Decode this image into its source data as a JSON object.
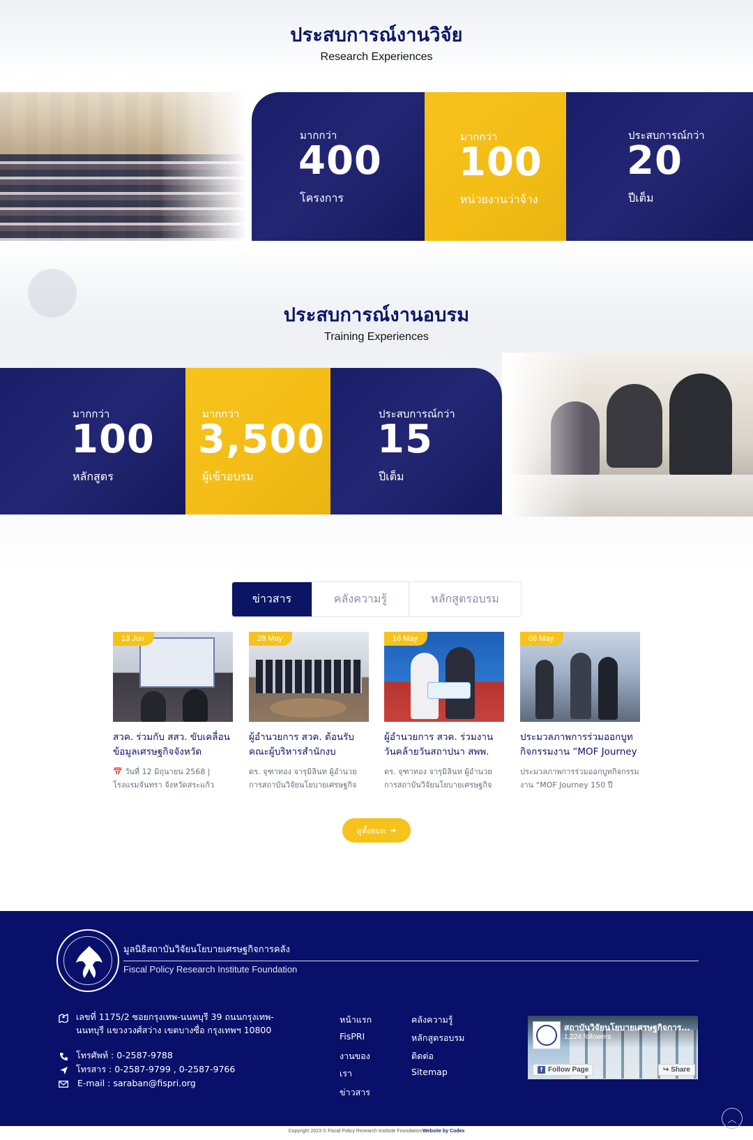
{
  "research": {
    "title_th": "ประสบการณ์งานวิจัย",
    "title_en": "Research Experiences",
    "stats": [
      {
        "pre": "มากกว่า",
        "num": "400",
        "post": "โครงการ",
        "color": "#1d2068"
      },
      {
        "pre": "มากกว่า",
        "num": "100",
        "post": "หน่วยงานว่าจ้าง",
        "color": "#f6c21c"
      },
      {
        "pre": "ประสบการณ์กว่า",
        "num": "20",
        "post": "ปีเต็ม",
        "color": "#1d2068"
      }
    ]
  },
  "training": {
    "title_th": "ประสบการณ์งานอบรม",
    "title_en": "Training Experiences",
    "stats": [
      {
        "pre": "มากกว่า",
        "num": "100",
        "post": "หลักสูตร",
        "color": "#1d2068"
      },
      {
        "pre": "มากกว่า",
        "num": "3,500",
        "post": "ผู้เข้าอบรม",
        "color": "#f6c21c"
      },
      {
        "pre": "ประสบการณ์กว่า",
        "num": "15",
        "post": "ปีเต็ม",
        "color": "#1d2068"
      }
    ]
  },
  "tabs": [
    {
      "label": "ข่าวสาร",
      "active": true
    },
    {
      "label": "คลังความรู้",
      "active": false
    },
    {
      "label": "หลักสูตรอบรม",
      "active": false
    }
  ],
  "news": [
    {
      "date": "13 Jun",
      "title": "สวค. ร่วมกับ สสว. ขับเคลื่อนข้อมูลเศรษฐกิจจังหวัด",
      "desc": "วันที่ 12 มิถุนายน 2568 | โรงแรมจันทรา จังหวัดสระแก้ว",
      "icon_calendar": "📅",
      "icon_pin": "📍"
    },
    {
      "date": "28 May",
      "title": "ผู้อำนวยการ สวค. ต้อนรับคณะผู้บริหารสำนักงบประมาณของ",
      "desc": "ดร. จุฑาทอง จารุมิลินท ผู้อำนวยการสถาบันวิจัยนโยบายเศรษฐกิจการ"
    },
    {
      "date": "16 May",
      "title": "ผู้อำนวยการ สวค. ร่วมงานวันคล้ายวันสถาปนา สพพ.",
      "desc": "ดร. จุฑาทอง จารุมิลินท ผู้อำนวยการสถาบันวิจัยนโยบายเศรษฐกิจการ"
    },
    {
      "date": "06 May",
      "title": "ประมวลภาพการร่วมออกบูทกิจกรรมงาน “MOF Journey",
      "desc": "ประมวลภาพการร่วมออกบูทกิจกรรมงาน “MOF Journey 150 ปี"
    }
  ],
  "view_all": {
    "label": "ดูทั้งหมด",
    "arrow": "➔"
  },
  "footer": {
    "org_th": "มูลนิธิสถาบันวิจัยนโยบายเศรษฐกิจการคลัง",
    "org_en": "Fiscal Policy Research Institute Foundation",
    "address_line1": "เลขที่ 1175/2 ซอยกรุงเทพ-นนทบุรี 39 ถนนกรุงเทพ-",
    "address_line2": "นนทบุรี แขวงวงศ์สว่าง เขตบางซื่อ กรุงเทพฯ 10800",
    "phone": "โทรศัพท์ : 0-2587-9788",
    "fax": "โทรสาร : 0-2587-9799 , 0-2587-9766",
    "email": "E-mail : saraban@fispri.org",
    "links_col1": [
      "หน้าแรก",
      "FisPRI",
      "งานของ",
      "เรา",
      "ข่าวสาร"
    ],
    "links_col2": [
      "คลังความรู้",
      "หลักสูตรอบรม",
      "ติดต่อ",
      "Sitemap"
    ],
    "fb": {
      "name": "สถาบันวิจัยนโยบายเศรษฐกิจการคลัง",
      "followers": "1,224 followers",
      "follow": "Follow Page",
      "share": "Share"
    }
  },
  "copyright": {
    "text": "Copyright 2023 © Fiscal Policy Research Institute Foundation/",
    "credit": "Website by Codex"
  },
  "colors": {
    "navy": "#0b1566",
    "yellow": "#f6c21c",
    "footer": "#09106a"
  }
}
